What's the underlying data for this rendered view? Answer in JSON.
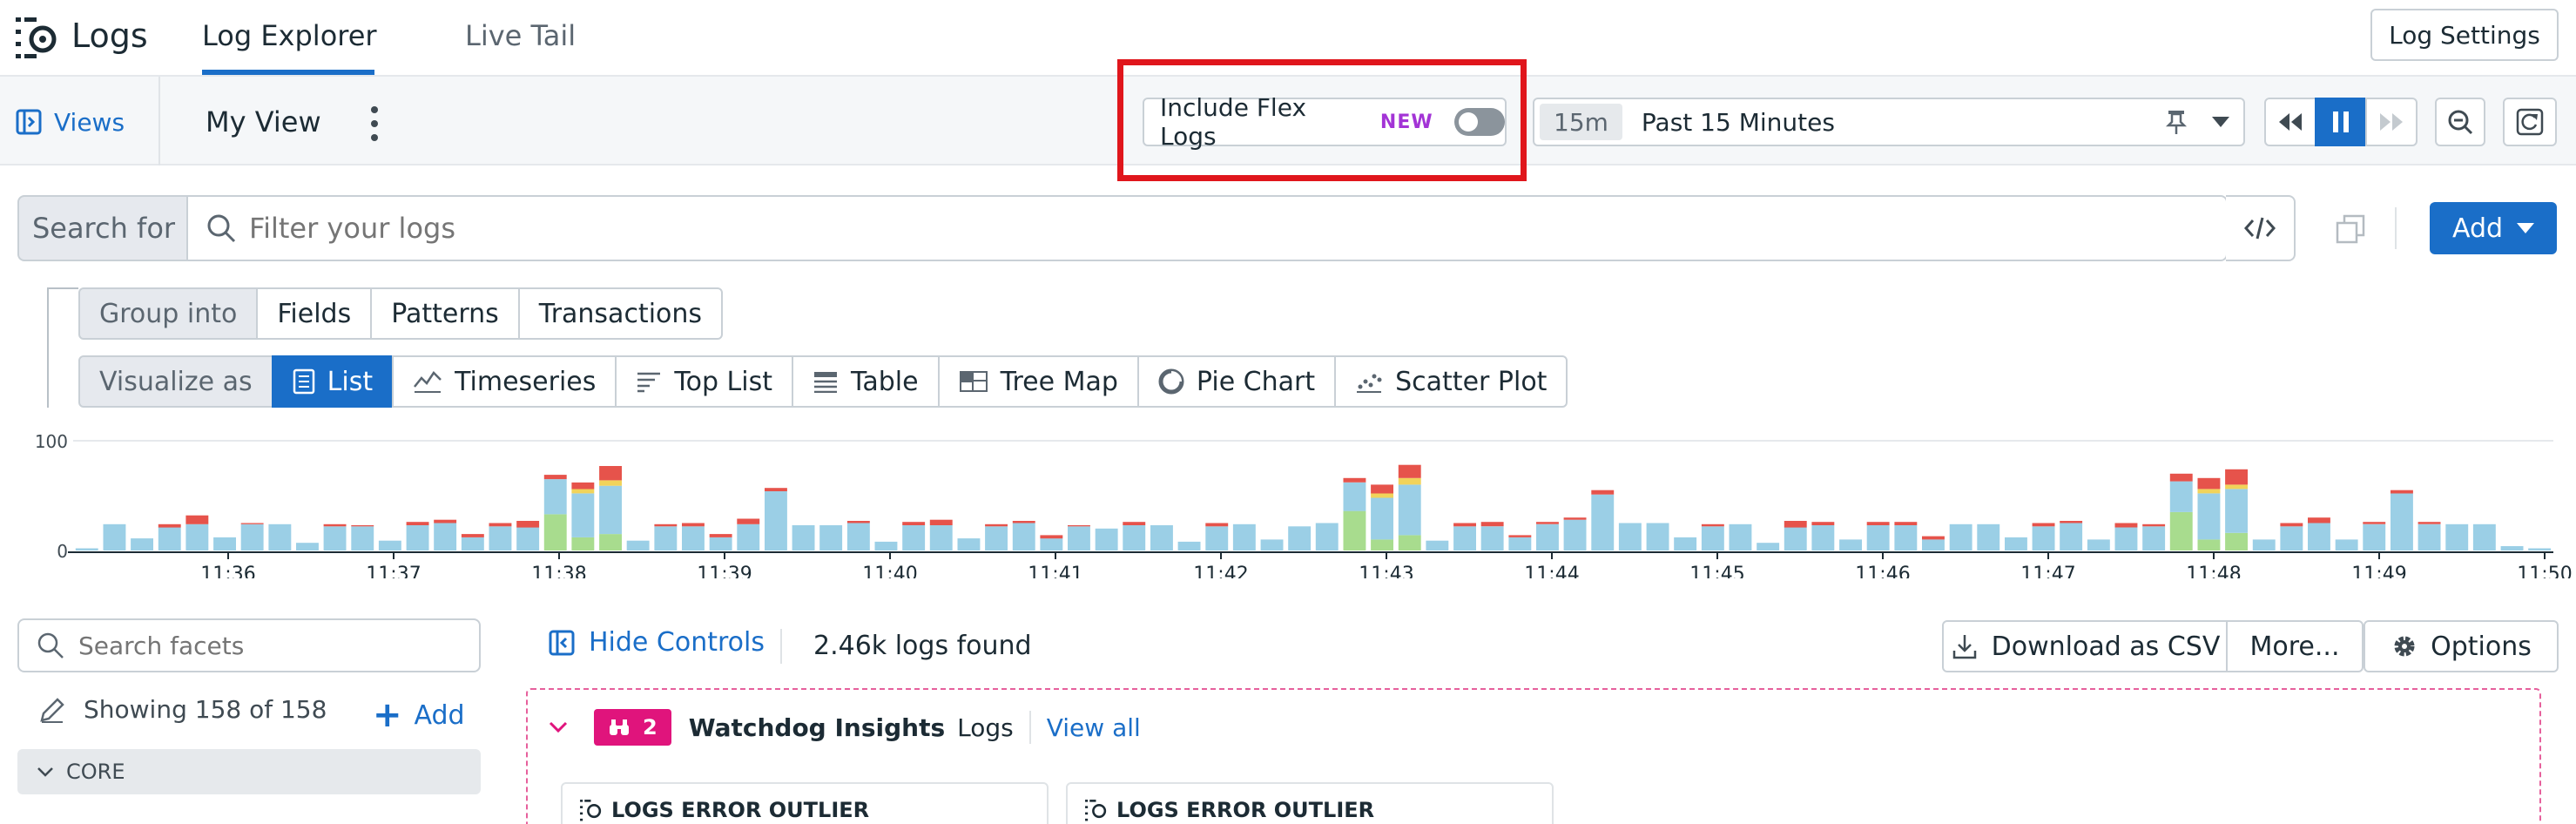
{
  "app": {
    "title": "Logs"
  },
  "nav": {
    "tabs": [
      {
        "label": "Log Explorer",
        "active": true
      },
      {
        "label": "Live Tail",
        "active": false
      }
    ],
    "settings_label": "Log Settings"
  },
  "viewbar": {
    "views_label": "Views",
    "view_title": "My View",
    "flex_logs": {
      "label": "Include Flex Logs",
      "badge": "NEW",
      "enabled": false
    },
    "time": {
      "short": "15m",
      "label": "Past 15 Minutes"
    }
  },
  "search": {
    "prefix": "Search for",
    "placeholder": "Filter your logs",
    "add_label": "Add"
  },
  "group": {
    "label": "Group into",
    "options": [
      "Fields",
      "Patterns",
      "Transactions"
    ]
  },
  "visualize": {
    "label": "Visualize as",
    "options": [
      {
        "label": "List",
        "icon": "list-icon",
        "active": true
      },
      {
        "label": "Timeseries",
        "icon": "timeseries-icon"
      },
      {
        "label": "Top List",
        "icon": "top-list-icon"
      },
      {
        "label": "Table",
        "icon": "table-icon"
      },
      {
        "label": "Tree Map",
        "icon": "tree-map-icon"
      },
      {
        "label": "Pie Chart",
        "icon": "pie-chart-icon"
      },
      {
        "label": "Scatter Plot",
        "icon": "scatter-plot-icon"
      }
    ]
  },
  "chart_data": {
    "type": "bar",
    "stacked": true,
    "ylim": [
      0,
      100
    ],
    "yticks": [
      0,
      100
    ],
    "xticks": [
      "11:36",
      "11:37",
      "11:38",
      "11:39",
      "11:40",
      "11:41",
      "11:42",
      "11:43",
      "11:44",
      "11:45",
      "11:46",
      "11:47",
      "11:48",
      "11:49",
      "11:50"
    ],
    "colors": {
      "info": "#9bcfe6",
      "error": "#e6534b",
      "ok": "#a8dc8e",
      "warn": "#f1d35a",
      "other": "#9aa1a8"
    },
    "series": [
      {
        "key": "ok",
        "values": [
          0,
          0,
          0,
          0,
          0,
          0,
          0,
          0,
          0,
          0,
          0,
          0,
          0,
          0,
          0,
          0,
          0,
          0,
          0,
          0,
          0,
          0,
          0,
          0,
          0,
          0,
          0,
          0,
          0,
          0,
          0,
          0,
          0,
          0,
          0,
          0,
          0,
          0,
          0,
          0,
          0,
          0,
          0,
          0,
          0,
          0,
          0,
          0,
          0,
          0,
          0,
          0,
          0,
          0,
          0,
          0,
          0,
          0,
          0,
          0,
          0,
          0,
          0,
          0,
          0,
          0,
          0,
          0,
          0,
          0,
          0,
          0,
          0,
          0,
          0,
          0,
          0,
          0,
          0,
          0,
          0,
          0,
          0,
          0,
          0,
          0,
          0,
          0,
          0,
          0,
          0,
          0,
          0,
          0,
          0,
          0,
          0,
          0,
          0,
          0,
          0,
          0,
          0,
          0,
          0,
          0,
          0,
          0,
          0,
          0,
          0,
          0,
          0,
          0,
          0,
          0,
          0,
          0,
          0,
          0,
          0,
          0,
          0,
          0,
          0,
          0,
          0,
          0,
          0,
          0,
          0,
          0,
          0,
          0,
          0,
          0,
          0,
          0,
          0,
          0,
          0,
          0,
          0,
          0,
          0,
          0,
          0,
          0,
          0,
          0
        ]
      },
      {
        "key": "info",
        "values": []
      },
      {
        "key": "error",
        "values": []
      }
    ],
    "bars": [
      [
        0,
        2,
        0,
        0
      ],
      [
        0,
        24,
        0,
        0
      ],
      [
        0,
        11,
        0,
        0
      ],
      [
        0,
        21,
        3,
        0
      ],
      [
        0,
        24,
        8,
        0
      ],
      [
        0,
        12,
        0,
        0
      ],
      [
        0,
        24,
        1,
        0
      ],
      [
        0,
        24,
        0,
        0
      ],
      [
        0,
        7,
        0,
        0
      ],
      [
        0,
        22,
        2,
        0
      ],
      [
        0,
        22,
        1,
        0
      ],
      [
        0,
        9,
        0,
        0
      ],
      [
        0,
        23,
        3,
        0
      ],
      [
        0,
        25,
        3,
        0
      ],
      [
        0,
        12,
        3,
        0
      ],
      [
        0,
        22,
        3,
        0
      ],
      [
        0,
        21,
        6,
        0
      ],
      [
        33,
        32,
        4,
        0
      ],
      [
        12,
        40,
        6,
        4
      ],
      [
        15,
        44,
        13,
        5
      ],
      [
        0,
        9,
        0,
        0
      ],
      [
        0,
        22,
        2,
        0
      ],
      [
        0,
        22,
        3,
        0
      ],
      [
        0,
        12,
        3,
        0
      ],
      [
        0,
        24,
        5,
        0
      ],
      [
        0,
        54,
        3,
        0
      ],
      [
        0,
        23,
        0,
        0
      ],
      [
        0,
        23,
        0,
        0
      ],
      [
        0,
        25,
        2,
        0
      ],
      [
        0,
        8,
        0,
        0
      ],
      [
        0,
        23,
        3,
        0
      ],
      [
        0,
        23,
        5,
        0
      ],
      [
        0,
        11,
        0,
        0
      ],
      [
        0,
        22,
        2,
        0
      ],
      [
        0,
        25,
        2,
        0
      ],
      [
        0,
        11,
        3,
        0
      ],
      [
        0,
        22,
        1,
        0
      ],
      [
        0,
        20,
        0,
        0
      ],
      [
        0,
        23,
        3,
        0
      ],
      [
        0,
        23,
        0,
        0
      ],
      [
        0,
        8,
        0,
        0
      ],
      [
        0,
        22,
        3,
        0
      ],
      [
        0,
        24,
        0,
        0
      ],
      [
        0,
        10,
        0,
        0
      ],
      [
        0,
        22,
        0,
        0
      ],
      [
        0,
        25,
        0,
        0
      ],
      [
        36,
        26,
        4,
        0
      ],
      [
        10,
        38,
        8,
        4
      ],
      [
        14,
        46,
        12,
        6
      ],
      [
        0,
        9,
        0,
        0
      ],
      [
        0,
        22,
        3,
        0
      ],
      [
        0,
        22,
        4,
        0
      ],
      [
        0,
        12,
        2,
        0
      ],
      [
        0,
        24,
        2,
        0
      ],
      [
        0,
        28,
        2,
        0
      ],
      [
        0,
        51,
        4,
        0
      ],
      [
        0,
        25,
        0,
        0
      ],
      [
        0,
        25,
        0,
        0
      ],
      [
        0,
        12,
        0,
        0
      ],
      [
        0,
        22,
        2,
        0
      ],
      [
        0,
        24,
        0,
        0
      ],
      [
        0,
        7,
        0,
        0
      ],
      [
        0,
        21,
        6,
        0
      ],
      [
        0,
        23,
        3,
        0
      ],
      [
        0,
        10,
        0,
        0
      ],
      [
        0,
        23,
        3,
        0
      ],
      [
        0,
        23,
        3,
        0
      ],
      [
        0,
        10,
        3,
        0
      ],
      [
        0,
        24,
        0,
        0
      ],
      [
        0,
        24,
        0,
        0
      ],
      [
        0,
        12,
        0,
        0
      ],
      [
        0,
        22,
        3,
        0
      ],
      [
        0,
        25,
        2,
        0
      ],
      [
        0,
        10,
        0,
        0
      ],
      [
        0,
        21,
        4,
        0
      ],
      [
        0,
        22,
        2,
        0
      ],
      [
        35,
        28,
        7,
        0
      ],
      [
        10,
        42,
        10,
        4
      ],
      [
        16,
        40,
        14,
        4
      ],
      [
        0,
        10,
        0,
        0
      ],
      [
        0,
        22,
        3,
        0
      ],
      [
        0,
        25,
        5,
        0
      ],
      [
        0,
        10,
        0,
        0
      ],
      [
        0,
        24,
        2,
        0
      ],
      [
        0,
        52,
        3,
        0
      ],
      [
        0,
        24,
        2,
        0
      ],
      [
        0,
        24,
        0,
        0
      ],
      [
        0,
        24,
        0,
        0
      ],
      [
        0,
        4,
        0,
        0
      ],
      [
        0,
        2,
        0,
        0
      ]
    ]
  },
  "facets": {
    "search_placeholder": "Search facets",
    "showing": "Showing 158 of 158",
    "add_label": "Add",
    "section": "CORE"
  },
  "results": {
    "hide_controls": "Hide Controls",
    "count": "2.46k logs found",
    "download": "Download as CSV",
    "more": "More...",
    "options": "Options"
  },
  "watchdog": {
    "count": "2",
    "title": "Watchdog Insights",
    "subtitle": "Logs",
    "view_all": "View all",
    "cards": [
      {
        "title": "LOGS ERROR OUTLIER"
      },
      {
        "title": "LOGS ERROR OUTLIER"
      }
    ]
  }
}
